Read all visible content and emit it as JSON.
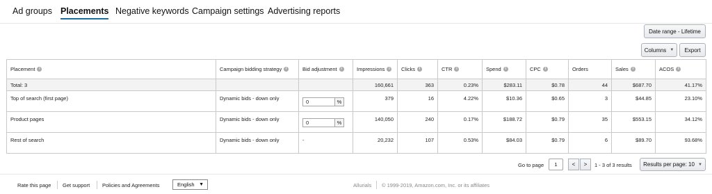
{
  "tabs": [
    {
      "label": "Ad groups"
    },
    {
      "label": "Placements",
      "active": true
    },
    {
      "label": "Negative keywords"
    },
    {
      "label": "Campaign settings"
    },
    {
      "label": "Advertising reports"
    }
  ],
  "toolbar": {
    "date_range_label": "Date range - Lifetime",
    "columns_label": "Columns",
    "export_label": "Export"
  },
  "table": {
    "headers": [
      "Placement",
      "Campaign bidding strategy",
      "Bid adjustment",
      "Impressions",
      "Clicks",
      "CTR",
      "Spend",
      "CPC",
      "Orders",
      "Sales",
      "ACOS"
    ],
    "total": {
      "placement": "Total: 3",
      "strategy": "",
      "bid": "",
      "impressions": "160,661",
      "clicks": "363",
      "ctr": "0.23%",
      "spend": "$283.11",
      "cpc": "$0.78",
      "orders": "44",
      "sales": "$687.70",
      "acos": "41.17%"
    },
    "rows": [
      {
        "placement": "Top of search (first page)",
        "strategy": "Dynamic bids - down only",
        "bid_value": "0",
        "bid_unit": "%",
        "impressions": "379",
        "clicks": "16",
        "ctr": "4.22%",
        "spend": "$10.36",
        "cpc": "$0.65",
        "orders": "3",
        "sales": "$44.85",
        "acos": "23.10%"
      },
      {
        "placement": "Product pages",
        "strategy": "Dynamic bids - down only",
        "bid_value": "0",
        "bid_unit": "%",
        "impressions": "140,050",
        "clicks": "240",
        "ctr": "0.17%",
        "spend": "$188.72",
        "cpc": "$0.79",
        "orders": "35",
        "sales": "$553.15",
        "acos": "34.12%"
      },
      {
        "placement": "Rest of search",
        "strategy": "Dynamic bids - down only",
        "bid_dash": "-",
        "impressions": "20,232",
        "clicks": "107",
        "ctr": "0.53%",
        "spend": "$84.03",
        "cpc": "$0.79",
        "orders": "6",
        "sales": "$89.70",
        "acos": "93.68%"
      }
    ]
  },
  "pagination": {
    "goto_label": "Go to page",
    "page_value": "1",
    "prev": "<",
    "next": ">",
    "range_text": "1 - 3 of 3 results",
    "per_page_label": "Results per page: 10"
  },
  "footer": {
    "links": [
      "Rate this page",
      "Get support",
      "Policies and Agreements"
    ],
    "language": "English",
    "brand": "Allurials",
    "copyright": "© 1999-2019, Amazon.com, Inc. or its affiliates"
  },
  "icons": {
    "info": "info-icon",
    "caret": "caret-down-icon"
  },
  "colors": {
    "active_tab_underline": "#1a6fa0",
    "total_row_bg": "#f3f3f3"
  }
}
